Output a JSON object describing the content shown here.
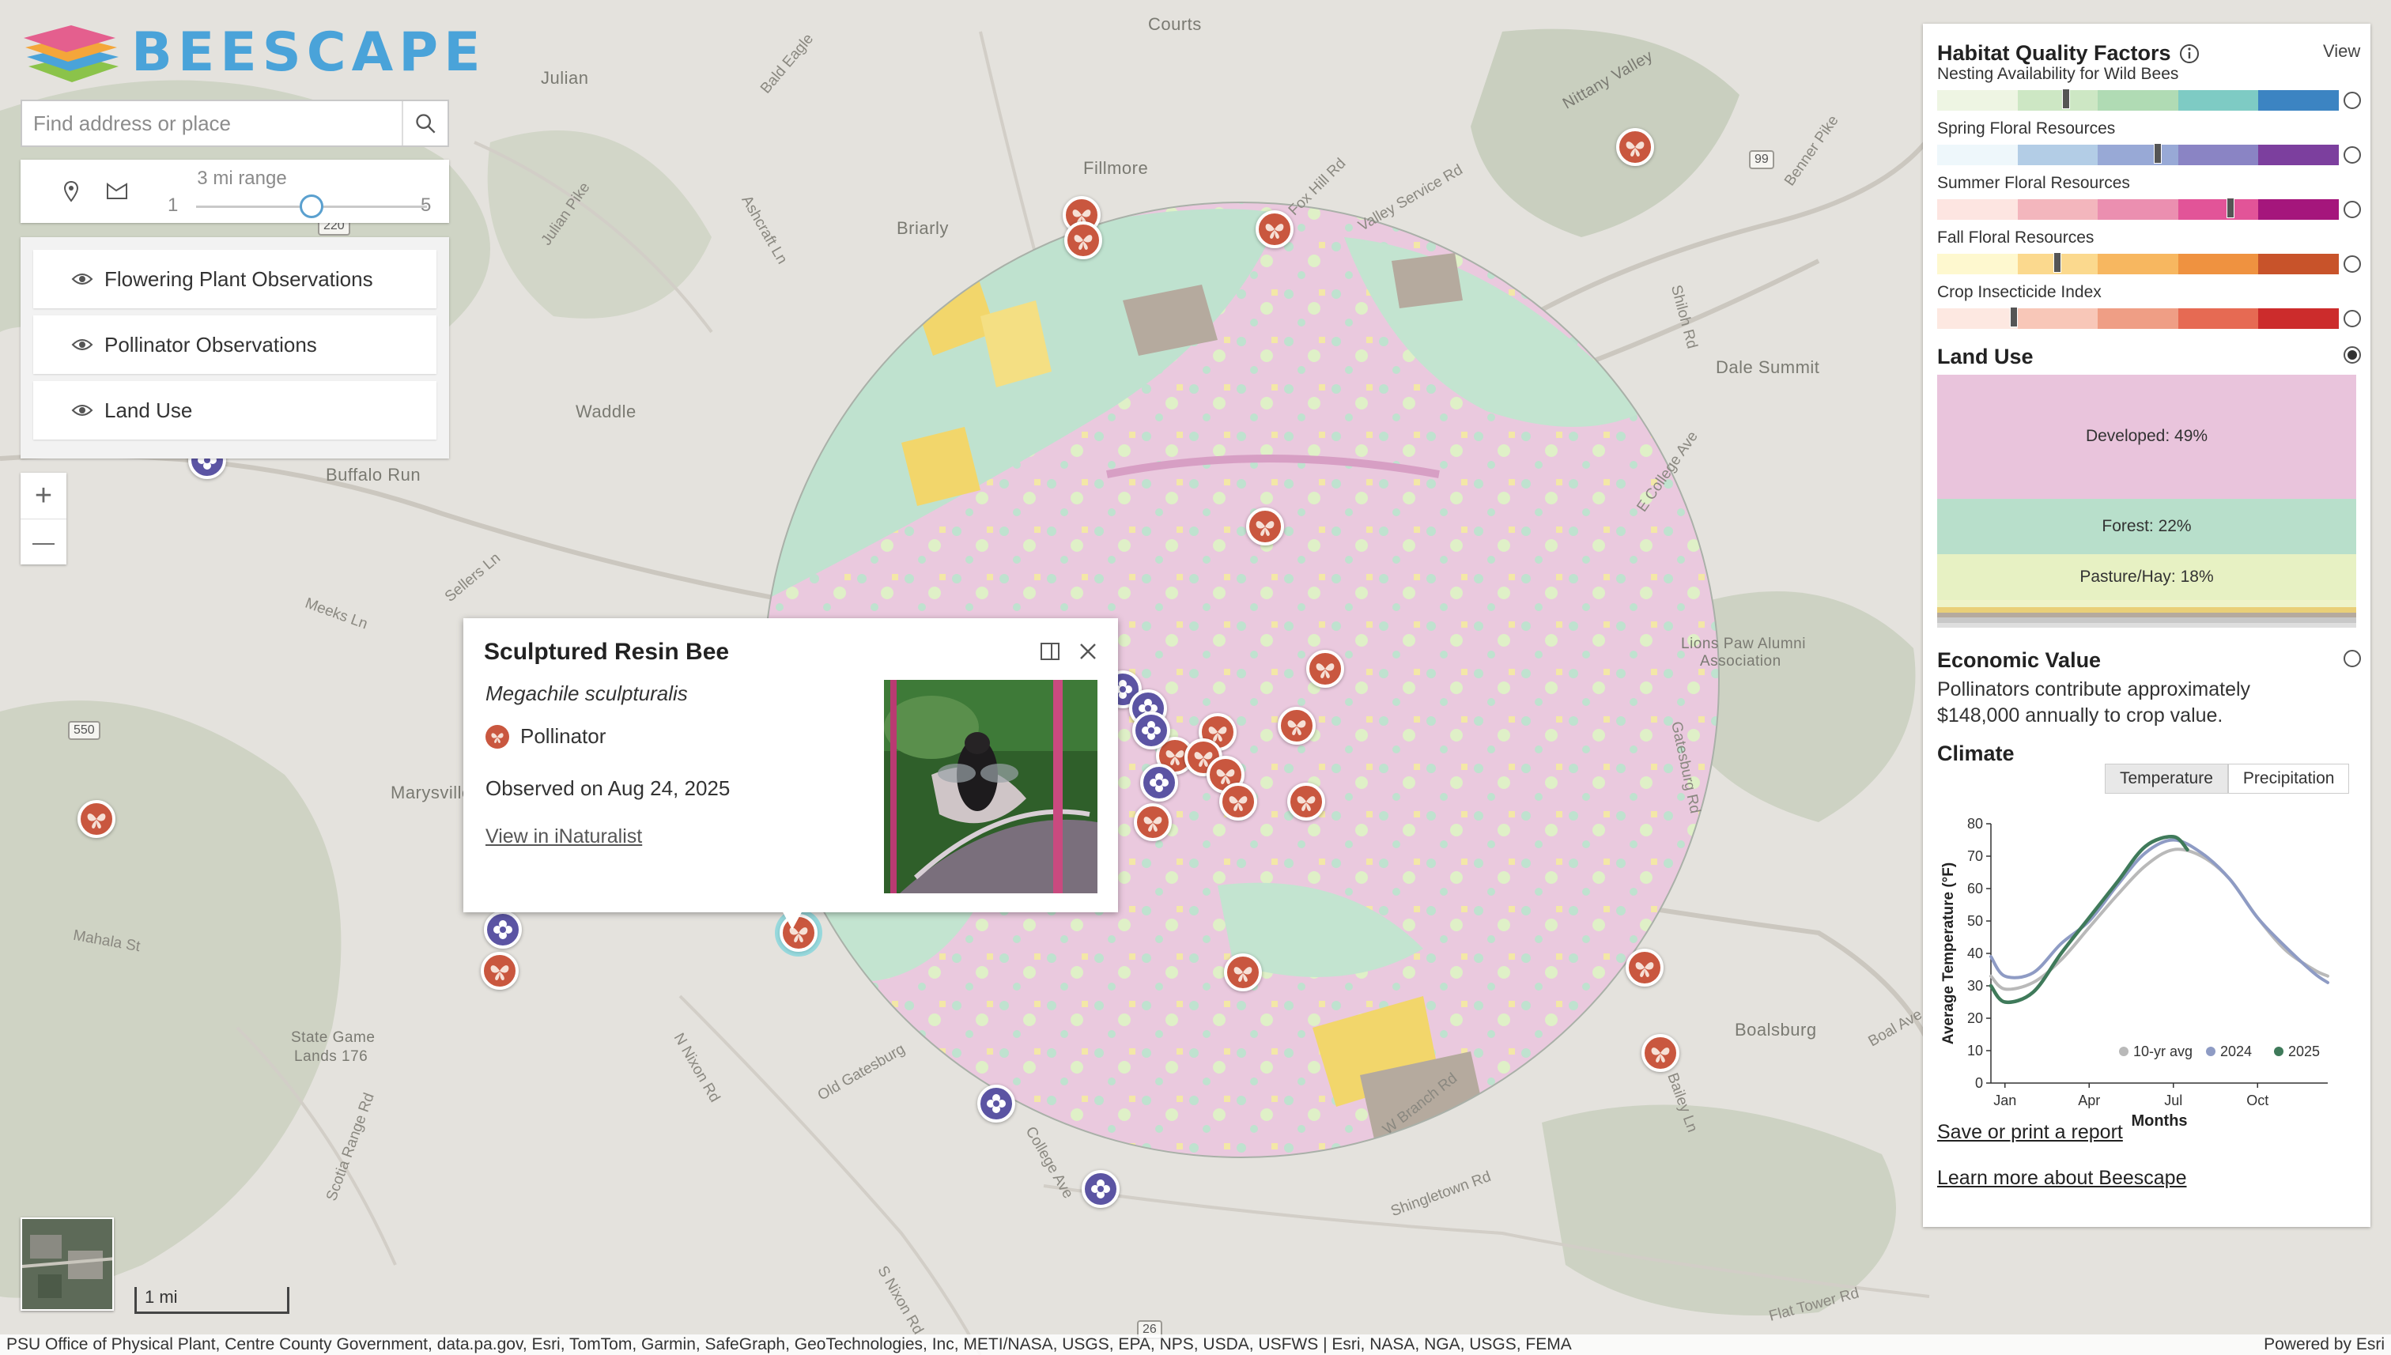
{
  "app": {
    "brand": "BEESCAPE"
  },
  "search": {
    "placeholder": "Find address or place",
    "icon": "search-icon"
  },
  "range": {
    "label": "3 mi range",
    "min": "1",
    "max": "5",
    "value": 3
  },
  "layers": [
    {
      "label": "Flowering Plant Observations",
      "icon": "eye-icon"
    },
    {
      "label": "Pollinator Observations",
      "icon": "eye-icon"
    },
    {
      "label": "Land Use",
      "icon": "eye-icon"
    }
  ],
  "zoom": {
    "in": "+",
    "out": "—"
  },
  "map_labels": {
    "places": [
      "Julian",
      "Fillmore",
      "Briarly",
      "Waddle",
      "Buffalo Run",
      "Dale Summit",
      "Lions Paw Alumni",
      "Association",
      "Marysville",
      "State Game",
      "Lands 176",
      "Boalsburg",
      "Courts",
      "Nittany Valley"
    ],
    "roads": [
      "Bald Eagle",
      "Julian Pike",
      "Ashcraft Ln",
      "Meeks Ln",
      "Sellers Ln",
      "Mahala St",
      "N Nixon Rd",
      "Scotia Range Rd",
      "Old Gatesburg",
      "College Ave",
      "S Nixon Rd",
      "Shingletown Rd",
      "W Branch Rd",
      "Bailey Ln",
      "E College Ave",
      "Shiloh Rd",
      "Benner Pike",
      "Fox Hill Rd",
      "Valley Service Rd",
      "Boal Ave",
      "Flat Tower Rd",
      "Gatesburg Rd"
    ],
    "shields": [
      "550",
      "220",
      "99",
      "26"
    ]
  },
  "scale": {
    "label": "1 mi"
  },
  "attribution": {
    "left": "PSU Office of Physical Plant, Centre County Government, data.pa.gov, Esri, TomTom, Garmin, SafeGraph, GeoTechnologies, Inc, METI/NASA, USGS, EPA, NPS, USDA, USFWS | Esri, NASA, NGA, USGS, FEMA",
    "right": "Powered by Esri"
  },
  "popup": {
    "title": "Sculptured Resin Bee",
    "scientific_name": "Megachile sculpturalis",
    "type": "Pollinator",
    "observed": "Observed on Aug 24, 2025",
    "link": "View in iNaturalist"
  },
  "panel": {
    "habitat_title": "Habitat Quality Factors",
    "view_label": "View",
    "factors": [
      {
        "label": "Nesting Availability for Wild Bees",
        "colors": [
          "#eef5e3",
          "#cde7c4",
          "#b0dbb4",
          "#7ecbc4",
          "#3c84c2"
        ],
        "level": 0.32,
        "selected": false
      },
      {
        "label": "Spring Floral Resources",
        "colors": [
          "#eef7fb",
          "#b3cde6",
          "#98a9d6",
          "#8a84c4",
          "#7c3f9e"
        ],
        "level": 0.55,
        "selected": false
      },
      {
        "label": "Summer Floral Resources",
        "colors": [
          "#fde5e1",
          "#f3b6bd",
          "#eb8fb0",
          "#e25498",
          "#a5167c"
        ],
        "level": 0.73,
        "selected": false
      },
      {
        "label": "Fall Floral Resources",
        "colors": [
          "#fef8cf",
          "#fbd98e",
          "#f7b760",
          "#ef9240",
          "#c8532a"
        ],
        "level": 0.3,
        "selected": false
      },
      {
        "label": "Crop Insecticide Index",
        "colors": [
          "#fde8e1",
          "#f8c7b8",
          "#ef9e85",
          "#e66a53",
          "#cc2c2c"
        ],
        "level": 0.19,
        "selected": false
      }
    ],
    "land_use": {
      "title": "Land Use",
      "selected": true,
      "segments": [
        {
          "label": "Developed: 49%",
          "pct": 49,
          "color": "#e9c4dc"
        },
        {
          "label": "Forest: 22%",
          "pct": 22,
          "color": "#b8dfcb"
        },
        {
          "label": "Pasture/Hay: 18%",
          "pct": 18,
          "color": "#e7f1c3"
        },
        {
          "label": "",
          "pct": 3,
          "color": "#eef3c9"
        },
        {
          "label": "",
          "pct": 2,
          "color": "#e9cf78"
        },
        {
          "label": "",
          "pct": 2,
          "color": "#b5aa9e"
        },
        {
          "label": "",
          "pct": 2,
          "color": "#c8c8c8"
        },
        {
          "label": "",
          "pct": 2,
          "color": "#dedede"
        }
      ]
    },
    "economic": {
      "title": "Economic Value",
      "text": "Pollinators contribute approximately $148,000 annually to crop value.",
      "selected": false
    },
    "climate": {
      "title": "Climate",
      "tabs": [
        "Temperature",
        "Precipitation"
      ],
      "active_tab": 0
    },
    "links": [
      "Save or print a report",
      "Learn more about Beescape"
    ]
  },
  "chart_data": {
    "type": "line",
    "ylabel": "Average Temperature (°F)",
    "xlabel": "Months",
    "ylim": [
      0,
      80
    ],
    "yticks": [
      0,
      10,
      20,
      30,
      40,
      50,
      60,
      70,
      80
    ],
    "xticks": [
      {
        "label": "Jan",
        "x": 1
      },
      {
        "label": "Apr",
        "x": 4
      },
      {
        "label": "Jul",
        "x": 7
      },
      {
        "label": "Oct",
        "x": 10
      }
    ],
    "xlim": [
      0.5,
      12.5
    ],
    "series": [
      {
        "name": "10-yr avg",
        "color": "#b9b9b9",
        "x": [
          0.5,
          1,
          2,
          3,
          4,
          5,
          6,
          7,
          8,
          9,
          10,
          11,
          12,
          12.5
        ],
        "values": [
          33,
          29,
          31,
          38,
          48,
          58,
          67,
          72,
          70,
          63,
          51,
          41,
          35,
          33
        ]
      },
      {
        "name": "2024",
        "color": "#8e9bc4",
        "x": [
          0.5,
          1,
          2,
          3,
          4,
          5,
          6,
          7,
          8,
          9,
          10,
          11,
          12,
          12.5
        ],
        "values": [
          39,
          33,
          34,
          43,
          50,
          61,
          71,
          75,
          71,
          63,
          51,
          42,
          34,
          31
        ]
      },
      {
        "name": "2025",
        "color": "#3f7a5a",
        "x": [
          0.5,
          1,
          2,
          3,
          4,
          5,
          6,
          7,
          7.5
        ],
        "values": [
          30,
          25,
          28,
          40,
          51,
          62,
          73,
          76,
          72
        ]
      }
    ],
    "legend_position": "bottom-right"
  }
}
